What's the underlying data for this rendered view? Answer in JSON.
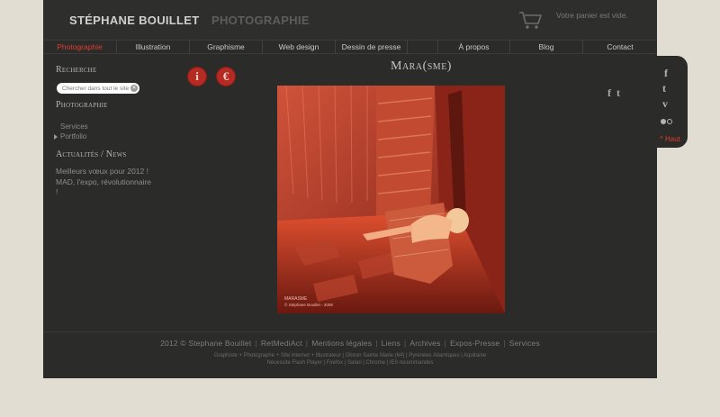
{
  "header": {
    "name": "STÉPHANE BOUILLET",
    "section": "PHOTOGRAPHIE",
    "cart_text": "Votre panier est vide.",
    "cart_icon": "cart-icon"
  },
  "nav": {
    "items": [
      {
        "label": "Photographie",
        "active": true
      },
      {
        "label": "Illustration",
        "active": false
      },
      {
        "label": "Graphisme",
        "active": false
      },
      {
        "label": "Web design",
        "active": false
      },
      {
        "label": "Dessin de presse",
        "active": false
      },
      {
        "label": "",
        "active": false
      },
      {
        "label": "À propos",
        "active": false
      },
      {
        "label": "Blog",
        "active": false
      },
      {
        "label": "Contact",
        "active": false
      }
    ]
  },
  "sidebar": {
    "search_heading": "Recherche",
    "search_placeholder": "Chercher dans tout le site",
    "photo_heading": "Photographie",
    "links": [
      "Services",
      "Portfolio"
    ],
    "news_heading": "Actualités / News",
    "news": [
      "Meilleurs vœux pour 2012 !",
      "MAD, l'expo, révolutionnaire",
      "!"
    ]
  },
  "icons": {
    "info": "i",
    "euro": "€"
  },
  "main": {
    "title": "Mara(sme)",
    "photo_caption_1": "MARASME",
    "photo_caption_2": "© Stéphane Bouillet - 2008"
  },
  "share": {
    "facebook": "f",
    "twitter": "t"
  },
  "footer": {
    "copyright": "2012 © Stephane Bouillet",
    "links": [
      "RetMediAct",
      "Mentions légales",
      "Liens",
      "Archives",
      "Expos-Presse",
      "Services"
    ],
    "small_line_1": "Graphiste + Photographe + Site internet + Illustrateur | Oloron Sainte Marie (64) | Pyrénées Atlantiques | Aquitaine",
    "small_line_2": "Nécessite Flash Player | Firefox | Safari | Chrome | IE9 recommandés"
  },
  "social": {
    "facebook": "f",
    "twitter": "t",
    "vimeo": "v",
    "top_label": "^ Haut"
  },
  "colors": {
    "page_bg": "#e2ddd2",
    "site_bg": "#2b2b29",
    "accent_red": "#e23b2e"
  }
}
